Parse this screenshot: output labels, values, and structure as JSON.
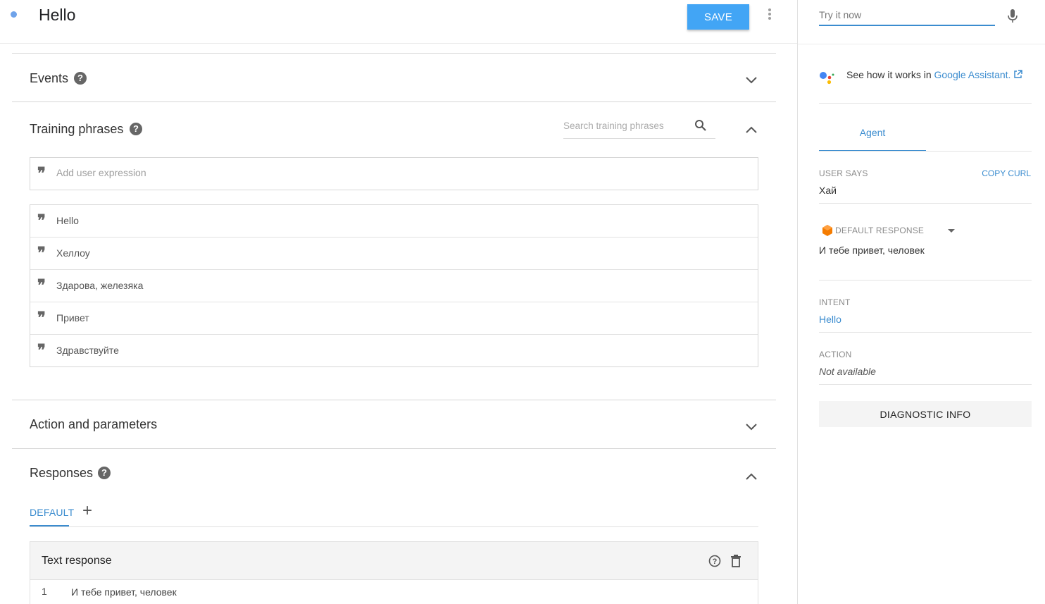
{
  "header": {
    "intent_name": "Hello",
    "save_label": "SAVE"
  },
  "sections": {
    "events": {
      "title": "Events"
    },
    "training": {
      "title": "Training phrases",
      "search_placeholder": "Search training phrases",
      "add_placeholder": "Add user expression",
      "phrases": [
        "Hello",
        "Хеллоу",
        "Здарова, железяка",
        "Привет",
        "Здравствуйте"
      ]
    },
    "action": {
      "title": "Action and parameters"
    },
    "responses": {
      "title": "Responses",
      "tab_default": "DEFAULT",
      "tab_add": "+",
      "text_response_title": "Text response",
      "rows": [
        {
          "num": "1",
          "text": "И тебе привет, человек"
        }
      ]
    }
  },
  "right_panel": {
    "try_placeholder": "Try it now",
    "see_how_prefix": "See how it works in ",
    "see_how_link": "Google Assistant.",
    "agent_tab": "Agent",
    "user_says_label": "USER SAYS",
    "copy_curl": "COPY CURL",
    "user_says_value": "Хай",
    "default_response_label": "DEFAULT RESPONSE",
    "default_response_value": "И тебе привет, человек",
    "intent_label": "INTENT",
    "intent_value": "Hello",
    "action_label": "ACTION",
    "action_value": "Not available",
    "diagnostic_label": "DIAGNOSTIC INFO"
  },
  "colors": {
    "accent": "#3b8ccf",
    "save_button": "#42a5f5",
    "status_dot": "#6fa3ea"
  }
}
